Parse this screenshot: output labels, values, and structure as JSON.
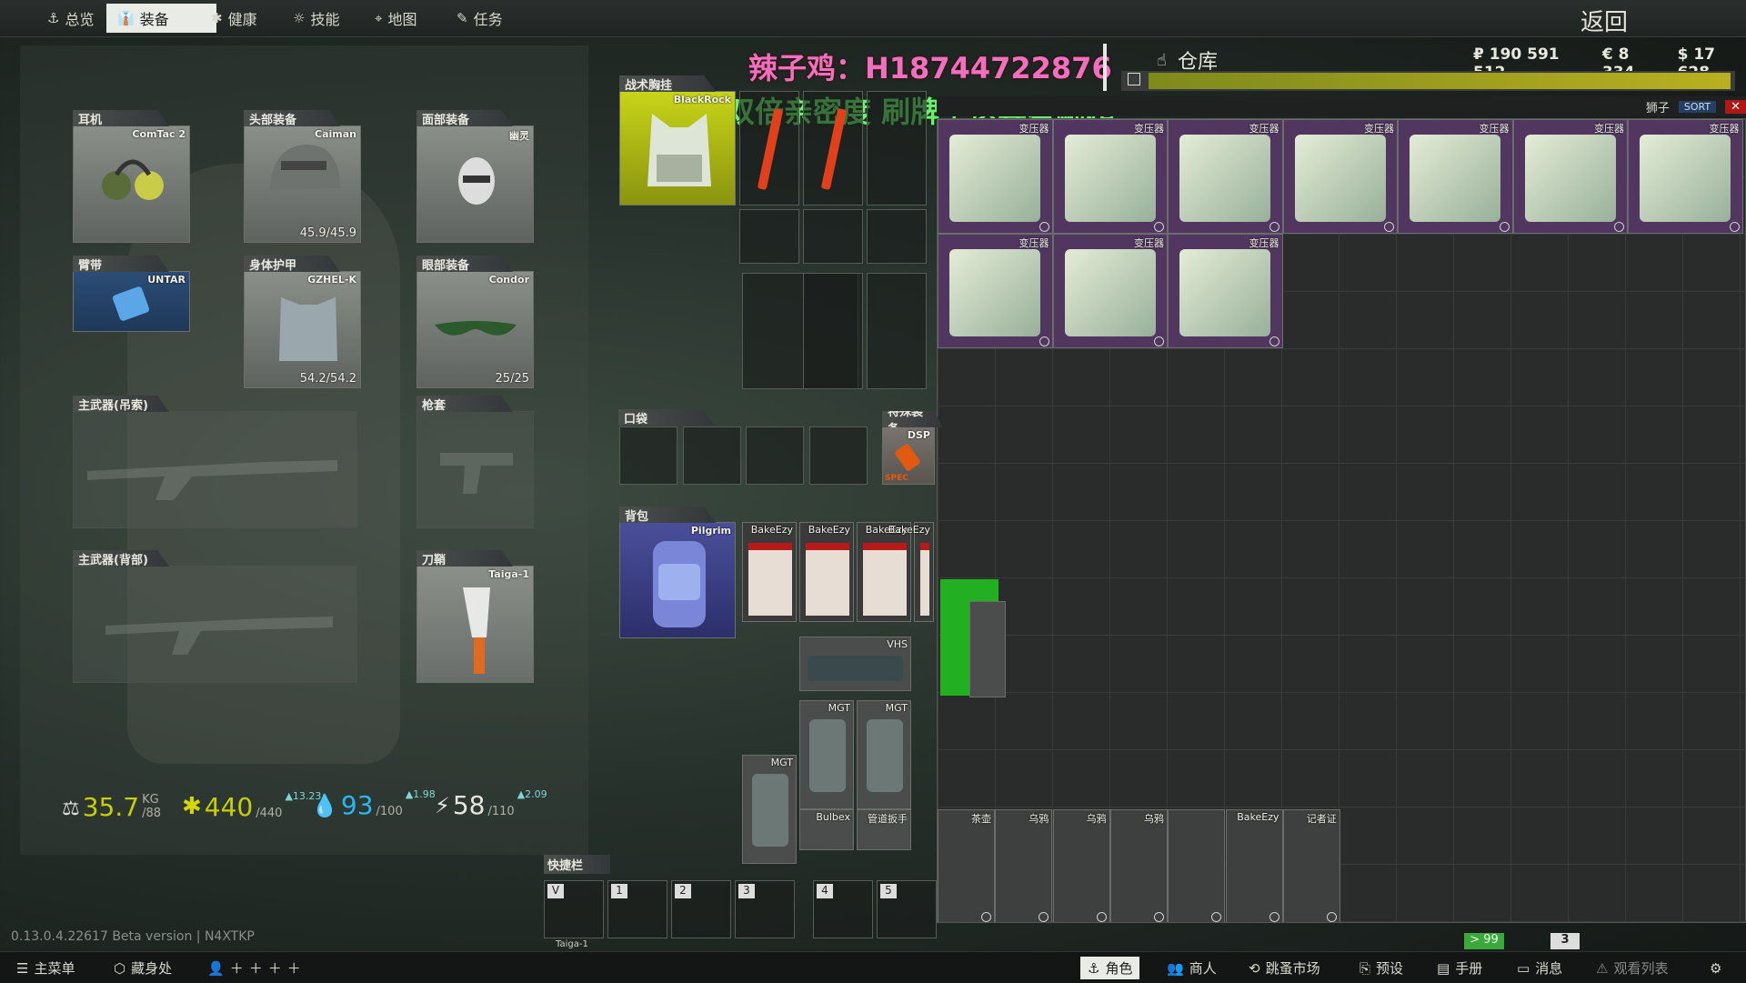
{
  "nav": {
    "tabs": [
      {
        "label": "总览",
        "icon": "⚓"
      },
      {
        "label": "装备",
        "icon": "👔"
      },
      {
        "label": "健康",
        "icon": "✱"
      },
      {
        "label": "技能",
        "icon": "☼"
      },
      {
        "label": "地图",
        "icon": "⌖"
      },
      {
        "label": "任务",
        "icon": "✎"
      }
    ],
    "active_index": 1,
    "back_label": "返回"
  },
  "overlay": {
    "line1": "辣子鸡：H18744722876",
    "line2": "双倍亲密度 刷牌子送异星崛起"
  },
  "stash": {
    "title": "仓库",
    "currency": {
      "rub": "₽ 190 591 512",
      "eur": "€ 8 334",
      "usd": "$ 17 628"
    },
    "trader": "狮子",
    "sort_label": "SORT",
    "close_icon": "✕",
    "transformer_name": "变压器",
    "bottom_items": [
      "茶壶",
      "乌鸦",
      "乌鸦",
      "乌鸦",
      "",
      "BakeEzy",
      "记者证"
    ],
    "counter_a": "> 99",
    "counter_b": "3"
  },
  "slots": {
    "earpiece": {
      "label": "耳机",
      "name": "ComTac 2"
    },
    "headwear": {
      "label": "头部装备",
      "name": "Caiman",
      "dur": "45.9/45.9"
    },
    "face": {
      "label": "面部装备",
      "name": "幽灵"
    },
    "armband": {
      "label": "臂带",
      "name": "UNTAR"
    },
    "armor": {
      "label": "身体护甲",
      "name": "GZHEL-K",
      "dur": "54.2/54.2"
    },
    "eyewear": {
      "label": "眼部装备",
      "name": "Condor",
      "dur": "25/25"
    },
    "primary_sling": {
      "label": "主武器(吊索)"
    },
    "holster": {
      "label": "枪套"
    },
    "primary_back": {
      "label": "主武器(背部)"
    },
    "scabbard": {
      "label": "刀鞘",
      "name": "Taiga-1"
    },
    "rig": {
      "label": "战术胸挂",
      "name": "BlackRock"
    },
    "pockets": {
      "label": "口袋"
    },
    "special": {
      "label": "特殊装备",
      "name": "DSP",
      "tag": "SPEC"
    },
    "backpack": {
      "label": "背包",
      "name": "Pilgrim"
    }
  },
  "backpack_items": [
    "BakeEzy",
    "BakeEzy",
    "BakeEzy",
    "BakeEzy",
    "VHS",
    "MGT",
    "MGT",
    "MGT",
    "Bulbex",
    "管道扳手"
  ],
  "quickbar": {
    "label": "快捷栏",
    "keys": [
      "V",
      "1",
      "2",
      "3",
      "4",
      "5"
    ],
    "v_item": "Taiga-1"
  },
  "stats": {
    "weight": "35.7",
    "weight_unit": "KG",
    "weight_max": "/88",
    "hp": "440",
    "hp_max": "/440",
    "hp_up": "▲13.23",
    "hydration": "93",
    "hydration_max": "/100",
    "hydration_up": "▲1.98",
    "energy": "58",
    "energy_max": "/110",
    "energy_up": "▲2.09"
  },
  "version": "0.13.0.4.22617 Beta version | N4XTKP",
  "bottom": {
    "left": [
      {
        "label": "主菜单"
      },
      {
        "label": "藏身处"
      }
    ],
    "right": [
      {
        "label": "角色"
      },
      {
        "label": "商人"
      },
      {
        "label": "跳蚤市场"
      },
      {
        "label": "预设"
      },
      {
        "label": "手册"
      },
      {
        "label": "消息"
      },
      {
        "label": "观看列表"
      }
    ]
  },
  "colors": {
    "accent": "#c6d000",
    "transformer_bg": "#51375f",
    "overlay_pink": "#f070c0",
    "overlay_green": "#6ef06e"
  }
}
